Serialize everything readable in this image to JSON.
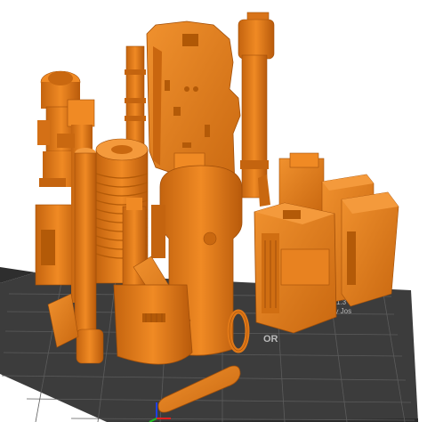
{
  "viewport": {
    "background": "#ffffff",
    "bed_color": "#3a3a3a",
    "grid_color": "#6a6a6a",
    "part_color": "#e07817",
    "part_shadow": "#a8520c",
    "part_highlight": "#f4a04a"
  },
  "bed": {
    "version_text": "1.3",
    "brand_text": "by Jos",
    "origin_text": "OR"
  },
  "axes": {
    "x_color": "#e02020",
    "y_color": "#20c020",
    "z_color": "#2040e0"
  },
  "icons": {
    "axis_gizmo": "axis-gizmo-icon"
  }
}
